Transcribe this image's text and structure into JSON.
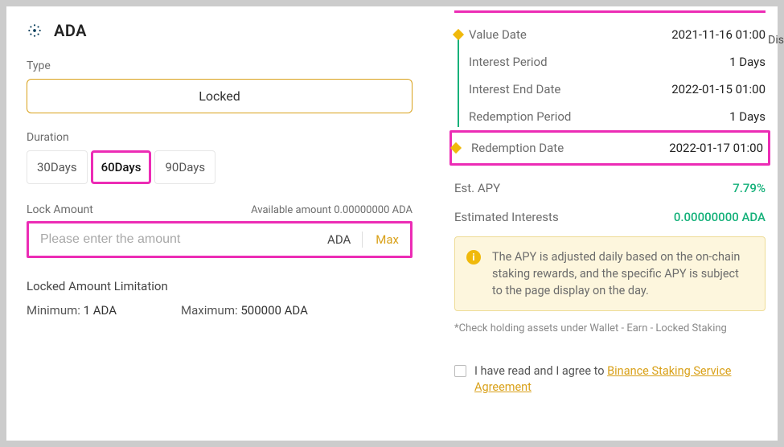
{
  "coin": {
    "name": "ADA"
  },
  "type": {
    "label": "Type",
    "option": "Locked"
  },
  "duration": {
    "label": "Duration",
    "options": [
      "30Days",
      "60Days",
      "90Days"
    ],
    "selected_index": 1
  },
  "lock_amount": {
    "label": "Lock Amount",
    "available_label": "Available amount 0.00000000 ADA",
    "placeholder": "Please enter the amount",
    "symbol": "ADA",
    "max_label": "Max"
  },
  "limitation": {
    "title": "Locked Amount Limitation",
    "min_label": "Minimum:",
    "min_value": "1 ADA",
    "max_label": "Maximum:",
    "max_value": "500000 ADA"
  },
  "timeline": {
    "value_date": {
      "label": "Value Date",
      "value": "2021-11-16 01:00"
    },
    "interest_period": {
      "label": "Interest Period",
      "value": "1 Days"
    },
    "interest_end": {
      "label": "Interest End Date",
      "value": "2022-01-15 01:00"
    },
    "redemption_period": {
      "label": "Redemption Period",
      "value": "1 Days"
    },
    "redemption_date": {
      "label": "Redemption Date",
      "value": "2022-01-17 01:00"
    }
  },
  "stats": {
    "apy": {
      "label": "Est. APY",
      "value": "7.79%"
    },
    "est_interests": {
      "label": "Estimated Interests",
      "value": "0.00000000 ADA"
    }
  },
  "info_text": "The APY is adjusted daily based on the on-chain staking rewards, and the specific APY is subject to the page display on the day.",
  "footnote": "*Check holding assets under Wallet - Earn - Locked Staking",
  "agreement": {
    "prefix": "I have read and I agree to ",
    "link": "Binance Staking Service Agreement"
  },
  "right_edge_fragment": "Dis"
}
